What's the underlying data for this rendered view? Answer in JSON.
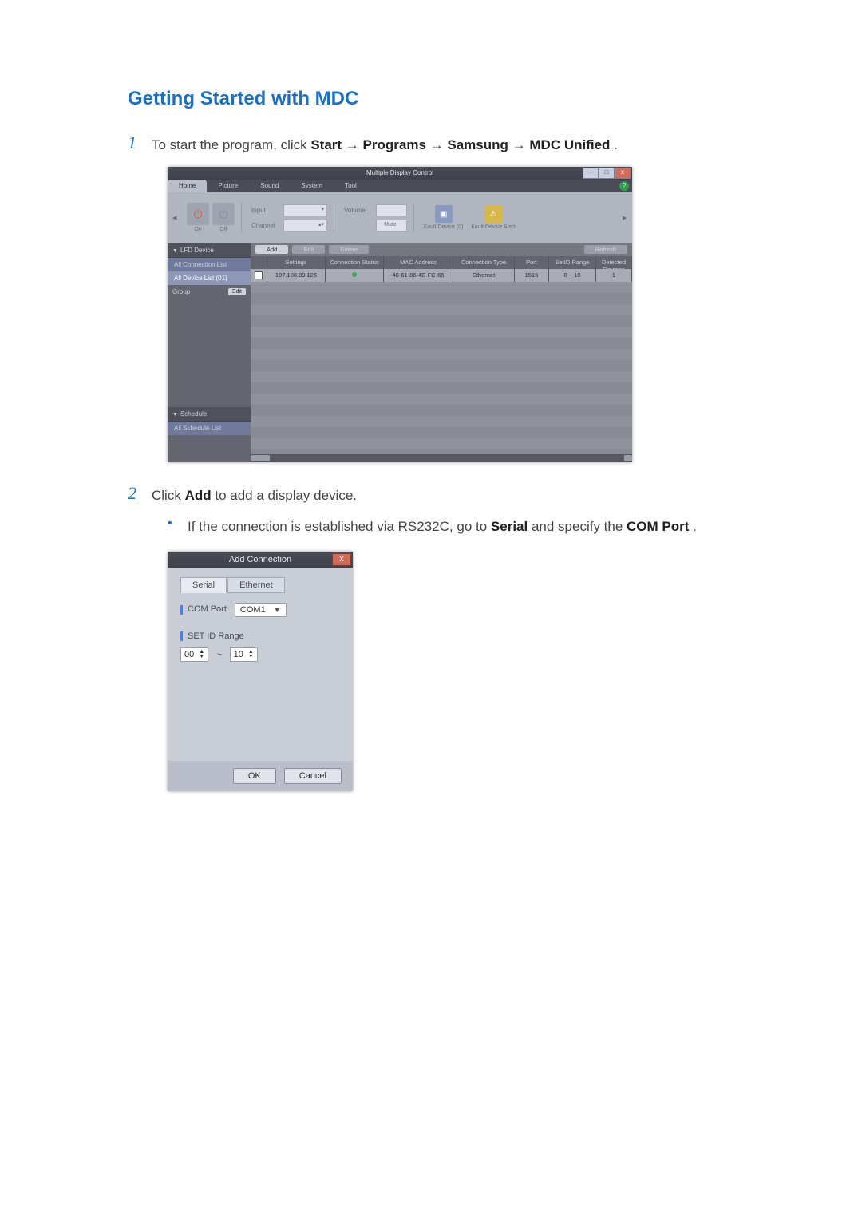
{
  "doc": {
    "heading": "Getting Started with MDC",
    "step1_num": "1",
    "step1_pre": "To start the program, click ",
    "step1_start": "Start",
    "step1_arrow": " → ",
    "step1_programs": "Programs",
    "step1_samsung": "Samsung",
    "step1_mdc": "MDC Unified",
    "step1_period": ".",
    "step2_num": "2",
    "step2_pre": "Click ",
    "step2_add": "Add",
    "step2_post": " to add a display device.",
    "bullet_pre": "If the connection is established via RS232C, go to ",
    "bullet_serial": "Serial",
    "bullet_mid": " and specify the ",
    "bullet_com": "COM Port",
    "bullet_period": "."
  },
  "mdc": {
    "title": "Multiple Display Control",
    "win_min": "—",
    "win_max": "□",
    "win_close": "x",
    "help": "?",
    "tabs": {
      "home": "Home",
      "picture": "Picture",
      "sound": "Sound",
      "system": "System",
      "tool": "Tool"
    },
    "ribbon": {
      "on": "On",
      "off": "Off",
      "input_lbl": "Input",
      "channel_lbl": "Channel",
      "volume_lbl": "Volume",
      "mute": "Mute",
      "fault0": "Fault Device (0)",
      "faultAlert": "Fault Device Alert"
    },
    "left": {
      "lfd": "LFD Device",
      "allconn": "All Connection List",
      "alldev": "All Device List (01)",
      "group": "Group",
      "edit": "Edit",
      "sched": "Schedule",
      "allsched": "All Schedule List"
    },
    "toolbar": {
      "add": "Add",
      "edit": "Edit",
      "delete": "Delete",
      "refresh": "Refresh"
    },
    "cols": {
      "settings": "Settings",
      "connstatus": "Connection Status",
      "mac": "MAC Address",
      "ctype": "Connection Type",
      "port": "Port",
      "setid": "SetID Range",
      "detected": "Detected Devices"
    },
    "row": {
      "settings": "107.108.89.126",
      "mac": "40-61-86-4E-FC-65",
      "ctype": "Ethernet",
      "port": "1515",
      "setid": "0 ~ 10",
      "detected": "1"
    }
  },
  "dlg": {
    "title": "Add Connection",
    "close": "x",
    "tab_serial": "Serial",
    "tab_eth": "Ethernet",
    "com_label": "COM Port",
    "com_value": "COM1",
    "setid_label": "SET ID Range",
    "setid_from": "00",
    "setid_sep": "~",
    "setid_to": "10",
    "ok": "OK",
    "cancel": "Cancel"
  }
}
